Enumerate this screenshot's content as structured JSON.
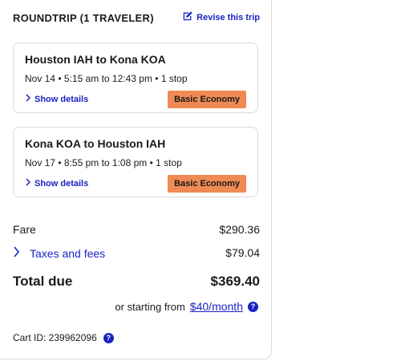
{
  "header": {
    "title": "ROUNDTRIP (1 TRAVELER)",
    "revise_label": "Revise this trip"
  },
  "flights": [
    {
      "route": "Houston IAH to Kona KOA",
      "times": "Nov 14 • 5:15 am to 12:43 pm • 1 stop",
      "details_label": "Show details",
      "fare_class": "Basic Economy"
    },
    {
      "route": "Kona KOA to Houston IAH",
      "times": "Nov 17 • 8:55 pm to 1:08 pm • 1 stop",
      "details_label": "Show details",
      "fare_class": "Basic Economy"
    }
  ],
  "summary": {
    "fare_label": "Fare",
    "fare_value": "$290.36",
    "taxes_label": "Taxes and fees",
    "taxes_value": "$79.04",
    "total_label": "Total due",
    "total_value": "$369.40",
    "monthly_prefix": "or starting from",
    "monthly_value": "$40/month"
  },
  "cart": {
    "label": "Cart ID: 239962096"
  },
  "colors": {
    "link": "#1b23c4",
    "badge": "#ef8a54",
    "border": "#d9d9d9"
  },
  "icons": {
    "revise": "edit-icon",
    "expand": "chevron-right-icon",
    "help": "question-icon"
  }
}
